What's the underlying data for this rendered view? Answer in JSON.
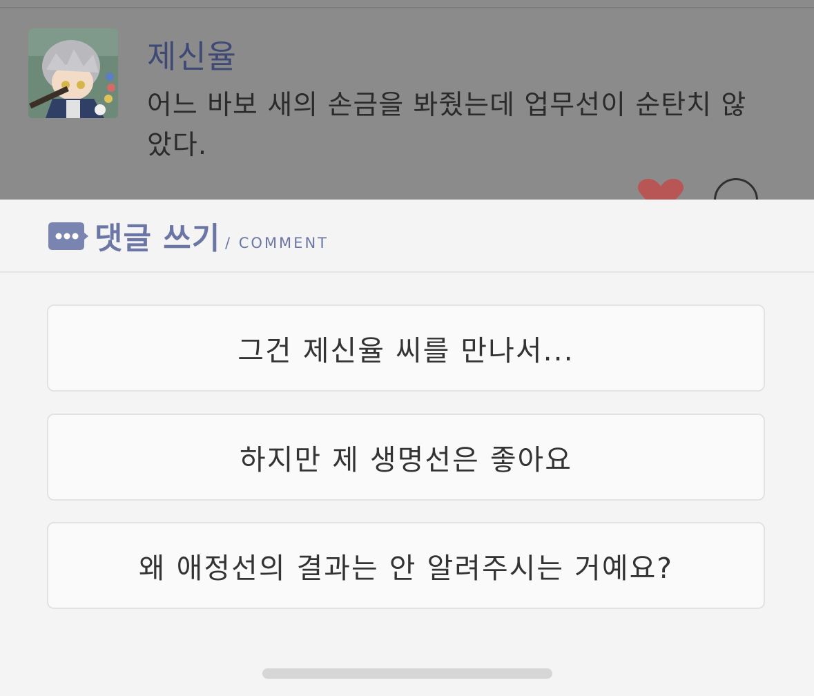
{
  "post": {
    "author": "제신율",
    "text": "어느 바보 새의 손금을 봐줬는데 업무선이 순탄치 않았다."
  },
  "comment_sheet": {
    "title": "댓글 쓰기",
    "subtitle": "/ COMMENT",
    "options": [
      "그건 제신율 씨를 만나서...",
      "하지만 제 생명선은 좋아요",
      "왜 애정선의 결과는 안 알려주시는 거예요?"
    ]
  },
  "colors": {
    "accent": "#6c76a4",
    "overlay": "#8b8b8b",
    "like": "#c05a5a"
  }
}
